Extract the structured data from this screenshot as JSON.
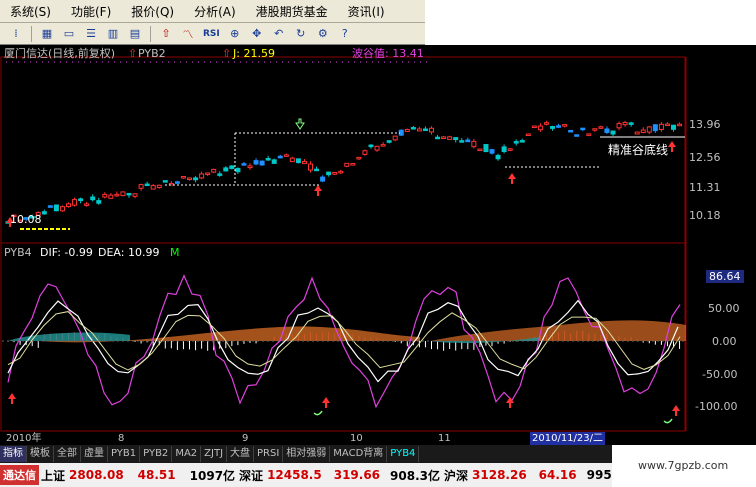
{
  "menu": [
    "系统(S)",
    "功能(F)",
    "报价(Q)",
    "分析(A)",
    "港股期货基金",
    "资讯(I)"
  ],
  "toolbar": {
    "rsi_label": "RSI"
  },
  "main_chart": {
    "title": "厦门信达(日线,前复权)",
    "indicator_name": "PYB2",
    "j_label": "J: 21.59",
    "bottom_value_label": "波谷值: 13.41",
    "left_low_label": "10.08",
    "note_text": "精准谷底线",
    "y_ticks": [
      "13.96",
      "12.56",
      "11.31",
      "10.18"
    ],
    "y_values": [
      13.96,
      12.56,
      11.31,
      10.18
    ]
  },
  "sub_chart": {
    "indicator": "PYB4",
    "dif_label": "DIF: -0.99",
    "dea_label": "DEA: 10.99",
    "m_label": "M",
    "y_ticks": [
      "86.64",
      "50.00",
      "0.00",
      "-50.00",
      "-100.00"
    ],
    "y_values": [
      86.64,
      50,
      0,
      -50,
      -100
    ]
  },
  "date_axis": {
    "labels": [
      "2010年",
      "8",
      "9",
      "10",
      "11"
    ],
    "selected_date": "2010/11/23/二"
  },
  "tabs": [
    "指标",
    "模板",
    "全部",
    "虚量",
    "PYB1",
    "PYB2",
    "MA2",
    "ZJTJ",
    "大盘",
    "PRSI",
    "相对强弱",
    "MACD背离",
    "PYB4"
  ],
  "status": {
    "brand": "通达信",
    "sh_name": "上证",
    "sh_value": "2808.08",
    "sh_change": "48.51",
    "sh_amount": "1097亿",
    "sz_name": "深证",
    "sz_value": "12458.5",
    "sz_change": "319.66",
    "sz_amount": "908.3亿",
    "hs_name": "沪深",
    "hs_value": "3128.26",
    "hs_change": "64.16",
    "hs_extra": "995"
  },
  "watermark": "www.7gpzb.com",
  "colors": {
    "up": "#ff3232",
    "down": "#1e90ff",
    "cyan": "#00c8c8",
    "magenta": "#e040e0",
    "white": "#ffffff",
    "yellow": "#ffff00",
    "orange_area": "#c06020",
    "teal_area": "#209090"
  }
}
